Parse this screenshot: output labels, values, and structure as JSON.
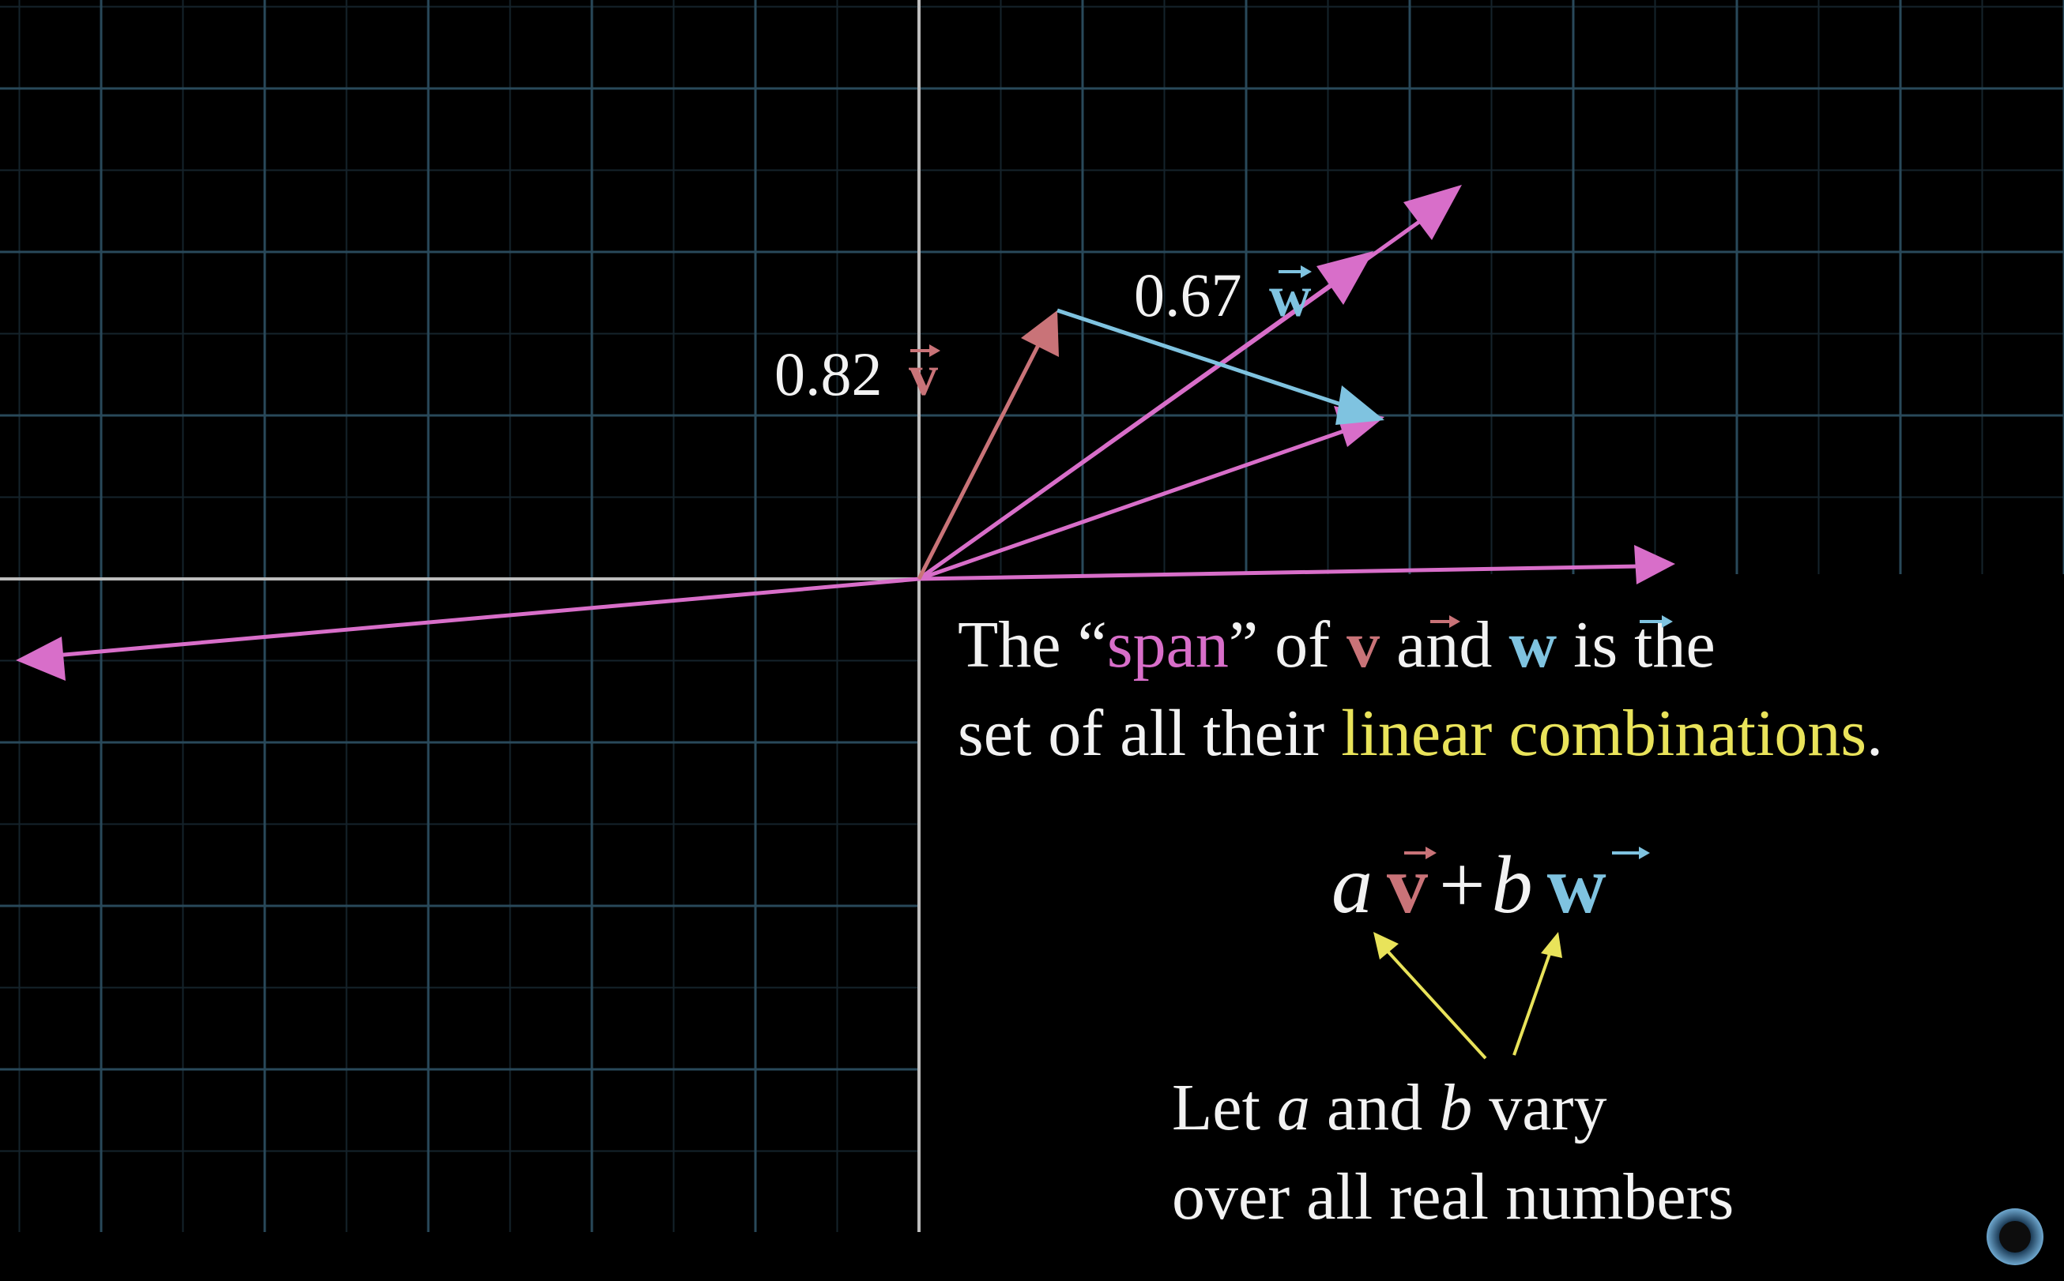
{
  "colors": {
    "background": "#000000",
    "grid_major": "#29495a",
    "grid_minor": "#15232b",
    "axis": "#bdbdbd",
    "v": "#c97378",
    "w": "#7fc3e0",
    "span": "#d86ec9",
    "highlight": "#e9e35a",
    "text": "#f2f2f2"
  },
  "labels": {
    "scaled_v_coeff": "0.82",
    "scaled_w_coeff": "0.67",
    "v_symbol": "v",
    "w_symbol": "w"
  },
  "definition": {
    "line1_pre": "The “",
    "line1_span": "span",
    "line1_mid": "” of ",
    "line1_and": " and ",
    "line1_post": " is the",
    "line2_pre": "set of all their ",
    "line2_highlight": "linear combinations",
    "line2_post": "."
  },
  "formula": {
    "a": "a",
    "plus": "+",
    "b": "b"
  },
  "note": {
    "line1_pre": "Let ",
    "line1_a": "a",
    "line1_mid": " and ",
    "line1_b": "b",
    "line1_post": " vary",
    "line2": "over all real numbers"
  },
  "icons": {
    "logo": "3b1b-pi-logo"
  }
}
